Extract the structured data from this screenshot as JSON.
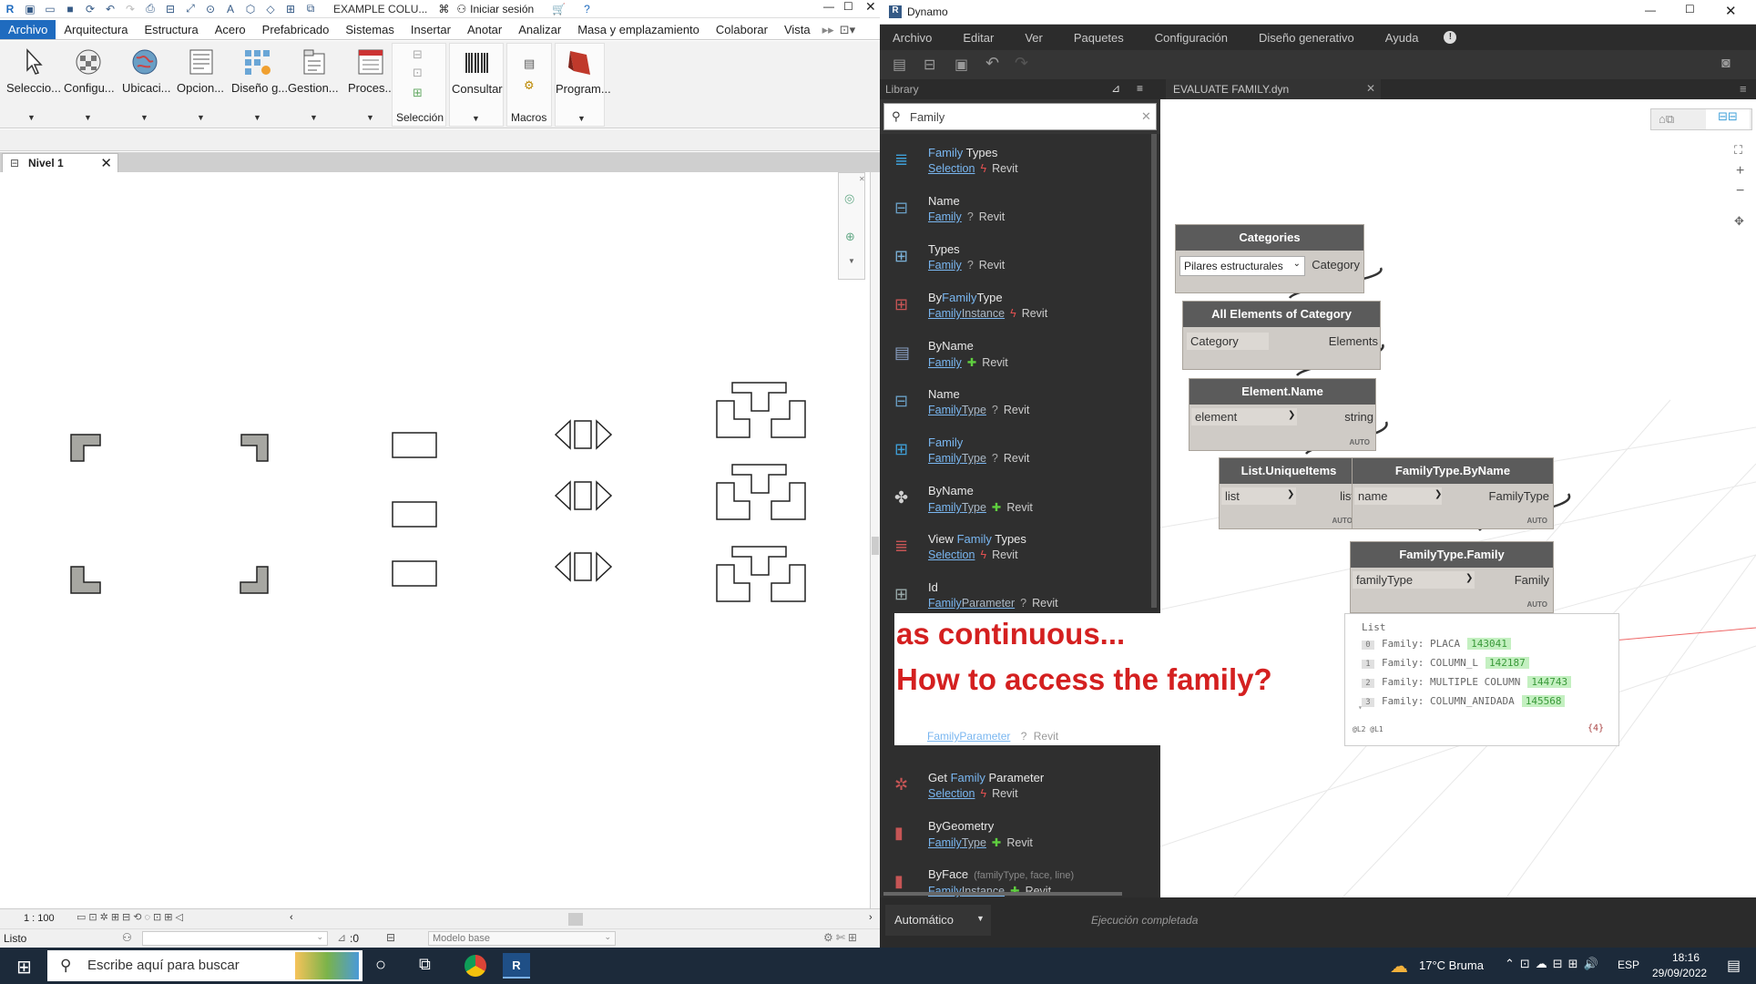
{
  "revit": {
    "qat_title": "EXAMPLE COLU...",
    "signin": "Iniciar sesión",
    "tabs": [
      "Archivo",
      "Arquitectura",
      "Estructura",
      "Acero",
      "Prefabricado",
      "Sistemas",
      "Insertar",
      "Anotar",
      "Analizar",
      "Masa y emplazamiento",
      "Colaborar",
      "Vista"
    ],
    "ribbon": {
      "buttons": [
        "Seleccio...",
        "Configu...",
        "Ubicaci...",
        "Opcion...",
        "Diseño g...",
        "Gestion...",
        "Proces...",
        "Consultar",
        "Program..."
      ],
      "panel_seleccion": "Selección",
      "panel_macros": "Macros"
    },
    "view_tab": "Nivel 1",
    "scale": "1 : 100",
    "status_text": "Listo",
    "model_label": "Modelo base",
    "zero": ":0"
  },
  "dynamo": {
    "title": "Dynamo",
    "menu": [
      "Archivo",
      "Editar",
      "Ver",
      "Paquetes",
      "Configuración",
      "Diseño generativo",
      "Ayuda"
    ],
    "library_label": "Library",
    "file_tab": "EVALUATE FAMILY.dyn",
    "search_value": "Family",
    "library_items": [
      {
        "pre": "",
        "hl": "Family",
        "post": " Types",
        "cat": "Selection",
        "cat_hl": "",
        "kind": "action",
        "src": "Revit"
      },
      {
        "pre": "Name",
        "hl": "",
        "post": "",
        "cat": "",
        "cat_hl": "Family",
        "kind": "query",
        "src": "Revit"
      },
      {
        "pre": "Types",
        "hl": "",
        "post": "",
        "cat": "",
        "cat_hl": "Family",
        "kind": "query",
        "src": "Revit"
      },
      {
        "pre": "By",
        "hl": "Family",
        "post": "Type",
        "cat": "Instance",
        "cat_hl": "Family",
        "kind": "action",
        "src": "Revit"
      },
      {
        "pre": "ByName",
        "hl": "",
        "post": "",
        "cat": "",
        "cat_hl": "Family",
        "kind": "create",
        "src": "Revit"
      },
      {
        "pre": "Name",
        "hl": "",
        "post": "",
        "cat": "Type",
        "cat_hl": "Family",
        "kind": "query",
        "src": "Revit"
      },
      {
        "pre": "",
        "hl": "Family",
        "post": "",
        "cat": "Type",
        "cat_hl": "Family",
        "kind": "query",
        "src": "Revit"
      },
      {
        "pre": "ByName",
        "hl": "",
        "post": "",
        "cat": "Type",
        "cat_hl": "Family",
        "kind": "create",
        "src": "Revit"
      },
      {
        "pre": "View ",
        "hl": "Family",
        "post": " Types",
        "cat": "Selection",
        "cat_hl": "",
        "kind": "action",
        "src": "Revit"
      },
      {
        "pre": "Id",
        "hl": "",
        "post": "",
        "cat": "Parameter",
        "cat_hl": "Family",
        "kind": "query",
        "src": "Revit"
      }
    ],
    "library_items_bottom": [
      {
        "pre": "Get ",
        "hl": "Family",
        "post": " Parameter",
        "cat": "Selection",
        "cat_hl": "",
        "kind": "action",
        "src": "Revit"
      },
      {
        "pre": "ByGeometry",
        "hl": "",
        "post": "",
        "cat": "Type",
        "cat_hl": "Family",
        "kind": "create",
        "src": "Revit"
      },
      {
        "pre": "ByFace",
        "hl": "",
        "post": "",
        "hint": "(familyType, face, line)",
        "cat": "Instance",
        "cat_hl": "Family",
        "kind": "create",
        "src": "Revit"
      }
    ],
    "partial_item": {
      "cat": "Parameter",
      "cat_hl": "Family",
      "src": "Revit"
    },
    "nodes": {
      "categories": {
        "title": "Categories",
        "dropdown": "Pilares estructurales",
        "out": "Category"
      },
      "all_elements": {
        "title": "All Elements of Category",
        "in": "Category",
        "out": "Elements"
      },
      "element_name": {
        "title": "Element.Name",
        "in": "element",
        "out": "string",
        "lacing": "AUTO"
      },
      "unique_items": {
        "title": "List.UniqueItems",
        "in": "list",
        "out": "list",
        "lacing": "AUTO"
      },
      "bytype_name": {
        "title": "FamilyType.ByName",
        "in": "name",
        "out": "FamilyType",
        "lacing": "AUTO"
      },
      "type_family": {
        "title": "FamilyType.Family",
        "in": "familyType",
        "out": "Family",
        "lacing": "AUTO"
      }
    },
    "watch": {
      "header": "List",
      "rows": [
        {
          "idx": "0",
          "text": "Family: PLACA",
          "id": "143041"
        },
        {
          "idx": "1",
          "text": "Family: COLUMN_L",
          "id": "142187"
        },
        {
          "idx": "2",
          "text": "Family: MULTIPLE COLUMN",
          "id": "144743"
        },
        {
          "idx": "3",
          "text": "Family: COLUMN_ANIDADA",
          "id": "145568"
        }
      ],
      "levels": "@L2 @L1",
      "count": "{4}"
    },
    "run_mode": "Automático",
    "run_status": "Ejecución completada"
  },
  "annotation": {
    "line1": "as continuous...",
    "line2": "How to access the family?"
  },
  "taskbar": {
    "search_placeholder": "Escribe aquí para buscar",
    "weather": "17°C  Bruma",
    "lang": "ESP",
    "time": "18:16",
    "date": "29/09/2022"
  },
  "colors": {
    "accent": "#1f6bbf",
    "annotation": "#d42020",
    "dynamo_dark": "#353535"
  }
}
